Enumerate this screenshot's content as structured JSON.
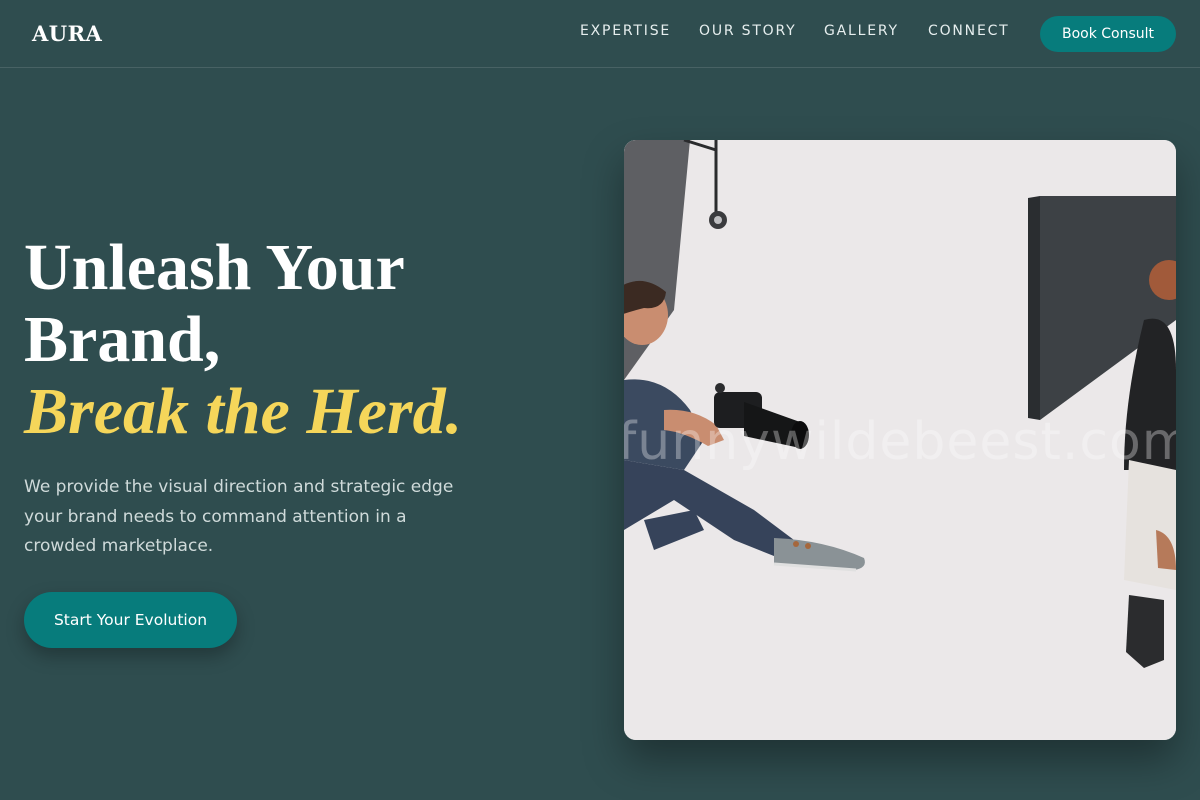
{
  "brand": {
    "logo": "AURA"
  },
  "nav": {
    "items": [
      {
        "label": "EXPERTISE"
      },
      {
        "label": "OUR STORY"
      },
      {
        "label": "GALLERY"
      },
      {
        "label": "CONNECT"
      }
    ],
    "book_button": "Book Consult"
  },
  "hero": {
    "headline_line1": "Unleash Your",
    "headline_line2": "Brand,",
    "headline_accent": "Break the Herd.",
    "intro": "We provide the visual direction and strategic edge your brand needs to command attention in a crowded marketplace.",
    "cta": "Start Your Evolution"
  },
  "image": {
    "watermark": "funnywildebeest.com",
    "subject": "photographer with camera photographing a model in a studio"
  },
  "colors": {
    "background": "#2f4d4f",
    "accent_teal": "#077c7c",
    "accent_yellow": "#f5d65a"
  }
}
